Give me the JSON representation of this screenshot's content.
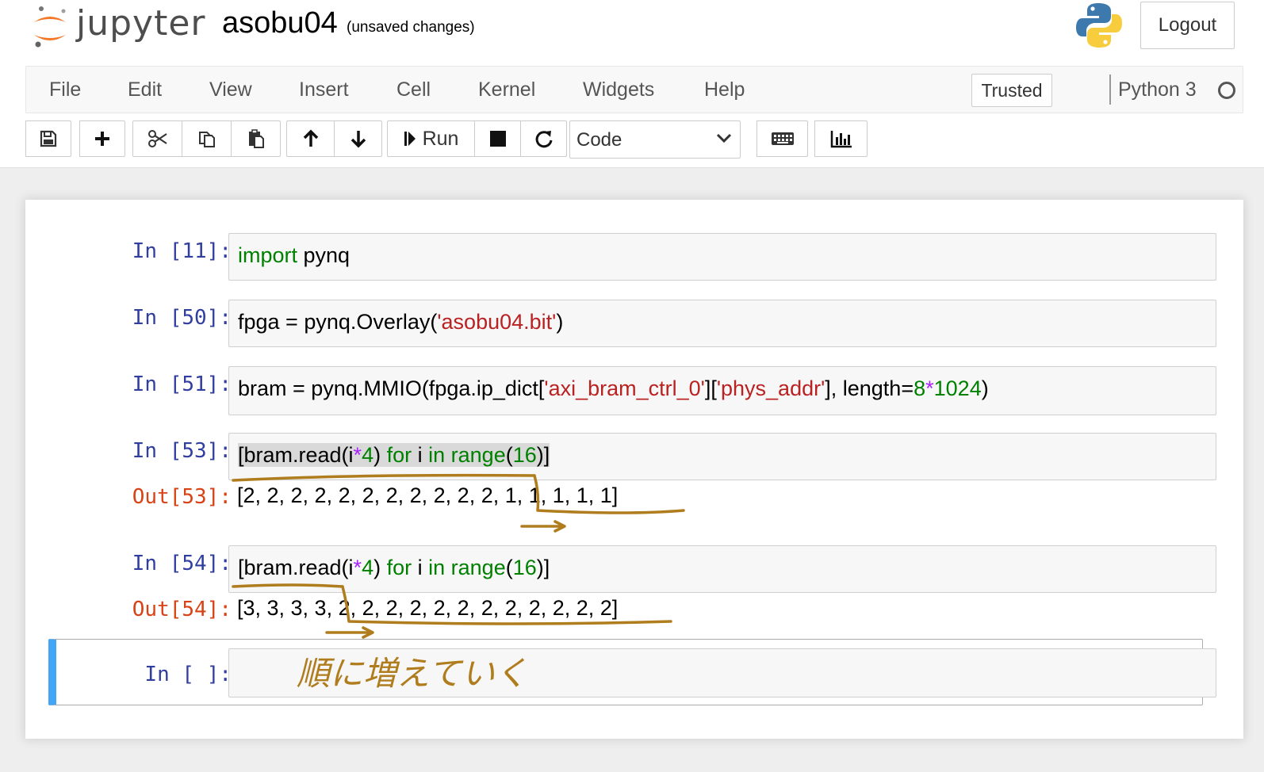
{
  "header": {
    "logo_name": "jupyter-logo",
    "logo_text": "jupyter",
    "notebook_title": "asobu04",
    "save_status": "(unsaved changes)",
    "logout_label": "Logout"
  },
  "menubar": {
    "items": [
      "File",
      "Edit",
      "View",
      "Insert",
      "Cell",
      "Kernel",
      "Widgets",
      "Help"
    ],
    "trusted_label": "Trusted",
    "kernel_name": "Python 3"
  },
  "toolbar": {
    "run_label": "Run",
    "cell_type": "Code",
    "icons": [
      "save-icon",
      "plus-icon",
      "scissors-icon",
      "copy-icon",
      "paste-icon",
      "arrow-up-icon",
      "arrow-down-icon",
      "step-forward-icon",
      "stop-icon",
      "restart-icon",
      "keyboard-icon",
      "bar-chart-icon"
    ]
  },
  "cells": [
    {
      "prompt": "In [11]:",
      "source": "import pynq"
    },
    {
      "prompt": "In [50]:",
      "source": "fpga = pynq.Overlay('asobu04.bit')"
    },
    {
      "prompt": "In [51]:",
      "source": "bram = pynq.MMIO(fpga.ip_dict['axi_bram_ctrl_0']['phys_addr'], length=8*1024)"
    },
    {
      "prompt": "In [53]:",
      "source": "[bram.read(i*4) for i in range(16)]",
      "out_prompt": "Out[53]:",
      "output": "[2, 2, 2, 2, 2, 2, 2, 2, 2, 2, 2, 1, 1, 1, 1, 1]"
    },
    {
      "prompt": "In [54]:",
      "source": "[bram.read(i*4) for i in range(16)]",
      "out_prompt": "Out[54]:",
      "output": "[3, 3, 3, 3, 2, 2, 2, 2, 2, 2, 2, 2, 2, 2, 2, 2]"
    },
    {
      "prompt": "In [ ]:",
      "source": ""
    }
  ],
  "annotation": {
    "handwritten_note": "順に増えていく",
    "ink_color": "#b07d1e"
  }
}
